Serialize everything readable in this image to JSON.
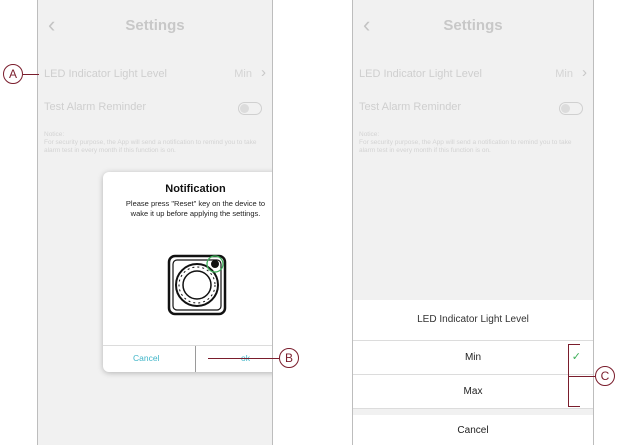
{
  "left_screen": {
    "nav": {
      "back_icon": "chevron-left-icon",
      "title": "Settings"
    },
    "settings": {
      "led_label": "LED Indicator Light Level",
      "led_value": "Min",
      "alarm_label": "Test Alarm Reminder",
      "notice": "Notice:\nFor security purpose, the App will send a notification to remind you to take alarm test in every month if this function is on."
    },
    "dialog": {
      "title": "Notification",
      "message": "Please press \"Reset\" key on the device to wake it up before applying the settings.",
      "cancel": "Cancel",
      "ok": "ok"
    }
  },
  "right_screen": {
    "nav": {
      "back_icon": "chevron-left-icon",
      "title": "Settings"
    },
    "settings": {
      "led_label": "LED Indicator Light Level",
      "led_value": "Min",
      "alarm_label": "Test Alarm Reminder",
      "notice": "Notice:\nFor security purpose, the App will send a notification to remind you to take alarm test in every month if this function is on."
    },
    "sheet": {
      "title": "LED Indicator Light Level",
      "options": [
        "Min",
        "Max"
      ],
      "selected": "Min",
      "check_icon": "checkmark-icon",
      "cancel": "Cancel"
    }
  },
  "callouts": {
    "a": "A",
    "b": "B",
    "c": "C"
  },
  "colors": {
    "accent": "#3fb5c8",
    "check": "#3fb05a",
    "callout": "#7a1d2c"
  }
}
